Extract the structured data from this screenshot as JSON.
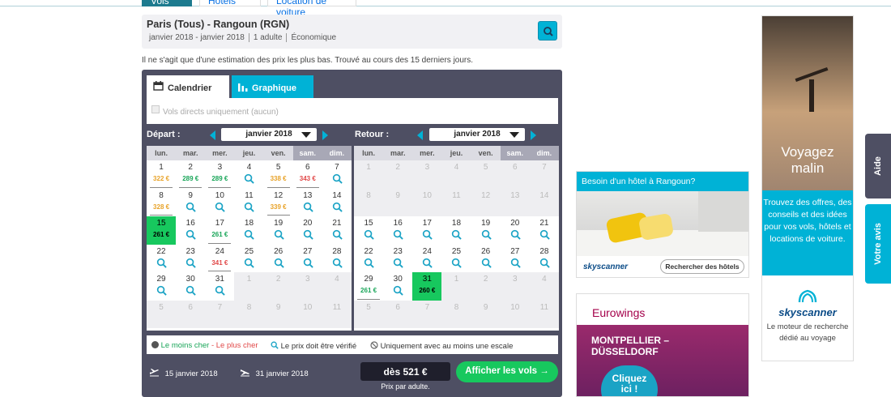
{
  "top_tabs": [
    "Vols",
    "Hôtels",
    "Location de voiture"
  ],
  "summary": {
    "route": "Paris (Tous) - Rangoun (RGN)",
    "dates": "janvier 2018 - janvier 2018",
    "adults": "1 adulte",
    "cabin": "Économique"
  },
  "estimate_note": "Il ne s'agit que d'une estimation des prix les plus bas. Trouvé au cours des 15 derniers jours.",
  "tabs": {
    "calendar": "Calendrier",
    "chart": "Graphique"
  },
  "filter_label": "Vols directs uniquement (aucun)",
  "departure": {
    "label": "Départ :",
    "month": "janvier 2018"
  },
  "return": {
    "label": "Retour :",
    "month": "janvier 2018"
  },
  "weekdays": [
    "lun.",
    "mar.",
    "mer.",
    "jeu.",
    "ven.",
    "sam.",
    "dim."
  ],
  "departure_days": [
    {
      "d": "1",
      "p": "322 €",
      "c": "pm"
    },
    {
      "d": "2",
      "p": "289 €",
      "c": "pc"
    },
    {
      "d": "3",
      "p": "289 €",
      "c": "pc"
    },
    {
      "d": "4",
      "q": true
    },
    {
      "d": "5",
      "p": "338 €",
      "c": "pm"
    },
    {
      "d": "6",
      "p": "343 €",
      "c": "pe"
    },
    {
      "d": "7",
      "q": true
    },
    {
      "d": "8",
      "p": "328 €",
      "c": "pm"
    },
    {
      "d": "9",
      "q": true
    },
    {
      "d": "10",
      "q": true
    },
    {
      "d": "11",
      "q": true
    },
    {
      "d": "12",
      "p": "339 €",
      "c": "pm"
    },
    {
      "d": "13",
      "q": true
    },
    {
      "d": "14",
      "q": true
    },
    {
      "d": "15",
      "p": "261 €",
      "sel": true
    },
    {
      "d": "16",
      "q": true
    },
    {
      "d": "17",
      "p": "261 €",
      "c": "pc"
    },
    {
      "d": "18",
      "q": true
    },
    {
      "d": "19",
      "q": true
    },
    {
      "d": "20",
      "q": true
    },
    {
      "d": "21",
      "q": true
    },
    {
      "d": "22",
      "q": true
    },
    {
      "d": "23",
      "q": true
    },
    {
      "d": "24",
      "p": "341 €",
      "c": "pe"
    },
    {
      "d": "25",
      "q": true
    },
    {
      "d": "26",
      "q": true
    },
    {
      "d": "27",
      "q": true
    },
    {
      "d": "28",
      "q": true
    },
    {
      "d": "29",
      "q": true
    },
    {
      "d": "30",
      "q": true
    },
    {
      "d": "31",
      "q": true
    },
    {
      "d": "1",
      "out": true
    },
    {
      "d": "2",
      "out": true
    },
    {
      "d": "3",
      "out": true
    },
    {
      "d": "4",
      "out": true
    },
    {
      "d": "5",
      "out": true
    },
    {
      "d": "6",
      "out": true
    },
    {
      "d": "7",
      "out": true
    },
    {
      "d": "8",
      "out": true
    },
    {
      "d": "9",
      "out": true
    },
    {
      "d": "10",
      "out": true
    },
    {
      "d": "11",
      "out": true
    }
  ],
  "return_days": [
    {
      "d": "1",
      "out": true
    },
    {
      "d": "2",
      "out": true
    },
    {
      "d": "3",
      "out": true
    },
    {
      "d": "4",
      "out": true
    },
    {
      "d": "5",
      "out": true
    },
    {
      "d": "6",
      "out": true
    },
    {
      "d": "7",
      "out": true
    },
    {
      "d": "8",
      "out": true
    },
    {
      "d": "9",
      "out": true
    },
    {
      "d": "10",
      "out": true
    },
    {
      "d": "11",
      "out": true
    },
    {
      "d": "12",
      "out": true
    },
    {
      "d": "13",
      "out": true
    },
    {
      "d": "14",
      "out": true
    },
    {
      "d": "15",
      "q": true
    },
    {
      "d": "16",
      "q": true
    },
    {
      "d": "17",
      "q": true
    },
    {
      "d": "18",
      "q": true
    },
    {
      "d": "19",
      "q": true
    },
    {
      "d": "20",
      "q": true
    },
    {
      "d": "21",
      "q": true
    },
    {
      "d": "22",
      "q": true
    },
    {
      "d": "23",
      "q": true
    },
    {
      "d": "24",
      "q": true
    },
    {
      "d": "25",
      "q": true
    },
    {
      "d": "26",
      "q": true
    },
    {
      "d": "27",
      "q": true
    },
    {
      "d": "28",
      "q": true
    },
    {
      "d": "29",
      "p": "261 €",
      "c": "pc"
    },
    {
      "d": "30",
      "q": true
    },
    {
      "d": "31",
      "p": "260 €",
      "sel": true
    },
    {
      "d": "1",
      "out": true
    },
    {
      "d": "2",
      "out": true
    },
    {
      "d": "3",
      "out": true
    },
    {
      "d": "4",
      "out": true
    },
    {
      "d": "5",
      "out": true
    },
    {
      "d": "6",
      "out": true
    },
    {
      "d": "7",
      "out": true
    },
    {
      "d": "8",
      "out": true
    },
    {
      "d": "9",
      "out": true
    },
    {
      "d": "10",
      "out": true
    },
    {
      "d": "11",
      "out": true
    }
  ],
  "legend": {
    "cheapest": "Le moins cher",
    "dash": " - ",
    "expensive": "Le plus cher",
    "verify": "Le prix doit être vérifié",
    "stopover": "Uniquement avec au moins une escale"
  },
  "footer": {
    "depart_date": "15 janvier 2018",
    "return_date": "31 janvier 2018",
    "price": "dès 521 €",
    "per_adult": "Prix par adulte.",
    "cta": "Afficher les vols →"
  },
  "hotel_ad": {
    "title": "Besoin d'un hôtel à Rangoun?",
    "brand": "skyscanner",
    "button": "Rechercher des hôtels"
  },
  "euro_ad": {
    "brand": "Eurowings",
    "city1": "MONTPELLIER –",
    "city2": "DÜSSELDORF",
    "click1": "Cliquez",
    "click2": "ici !"
  },
  "right_ad": {
    "title1": "Voyagez",
    "title2": "malin",
    "blurb": "Trouvez des offres, des conseils et des idées pour vos vols, hôtels et locations de voiture.",
    "brand": "skyscanner",
    "tagline": "Le moteur de recherche dédié au voyage"
  },
  "side_tabs": {
    "help": "Aide",
    "feedback": "Votre avis"
  },
  "colors": {
    "cheapest": "#18a558",
    "medium": "#e8a32a",
    "expensive": "#e14848",
    "selected": "#17c85e",
    "accent": "#00b2d6",
    "panel": "#4e4f63"
  }
}
